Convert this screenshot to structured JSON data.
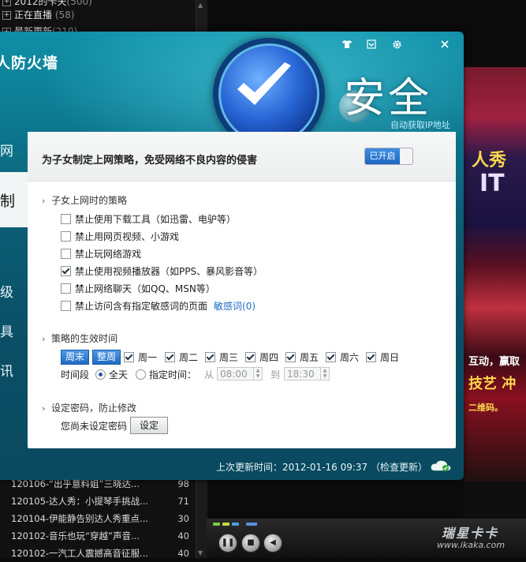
{
  "background": {
    "top_items": [
      {
        "label": "2012的卡夫",
        "count": "(500)"
      },
      {
        "label": "正在直播",
        "count": "(58)"
      },
      {
        "label": "最新更新",
        "count": "(219)"
      }
    ],
    "video_text": [
      "人秀",
      "IT",
      "互动，赢取",
      "技艺 冲",
      "二维码。"
    ],
    "list": [
      {
        "title": "120106-“出乎意料姐”三晓达...",
        "count": "98"
      },
      {
        "title": "120105-达人秀：小提琴手挑战...",
        "count": "71"
      },
      {
        "title": "120104-伊能静告别达人秀重点...",
        "count": "30"
      },
      {
        "title": "120102-音乐也玩“穿越”声音...",
        "count": "40"
      },
      {
        "title": "120102-一汽工人震撼高音征服...",
        "count": "40"
      }
    ],
    "watermark": {
      "brand": "瑞星卡卡",
      "url": "www.ikaka.com"
    }
  },
  "window": {
    "app_title": "个人防火墙",
    "banner_title": "安全",
    "auto_ip": "自动获取IP地址",
    "controls": {
      "skin": "shirt-icon",
      "minimize": "minimize-icon",
      "settings": "gear-icon",
      "close": "close-icon"
    },
    "side_nav": [
      "网",
      "制",
      "级",
      "具",
      "讯"
    ],
    "panel": {
      "heading": "为子女制定上网策略，免受网络不良内容的侵害",
      "toggle_label": "已开启",
      "section_policy": "子女上网时的策略",
      "rules": [
        {
          "label": "禁止使用下载工具（如迅雷、电驴等）",
          "checked": false
        },
        {
          "label": "禁止用网页视频、小游戏",
          "checked": false
        },
        {
          "label": "禁止玩网络游戏",
          "checked": false
        },
        {
          "label": "禁止使用视频播放器（如PPS、暴风影音等）",
          "checked": true
        },
        {
          "label": "禁止网络聊天（如QQ、MSN等）",
          "checked": false
        },
        {
          "label": "禁止访问含有指定敏感词的页面",
          "checked": false
        }
      ],
      "sensitive_link": "敏感词(0)",
      "section_time": "策略的生效时间",
      "btn_weekend": "周末",
      "btn_week": "整周",
      "days": [
        "周一",
        "周二",
        "周三",
        "周四",
        "周五",
        "周六",
        "周日"
      ],
      "period_label": "时间段",
      "all_day": "全天",
      "custom_time": "指定时间：",
      "from": "从",
      "to": "到",
      "time_from": "08:00",
      "time_to": "18:30",
      "section_password": "设定密码，防止修改",
      "password_status": "您尚未设定密码",
      "set_button": "设定"
    },
    "footer": {
      "update_prefix": "上次更新时间：",
      "update_time": "2012-01-16 09:37",
      "check_update": "（检查更新）"
    }
  }
}
